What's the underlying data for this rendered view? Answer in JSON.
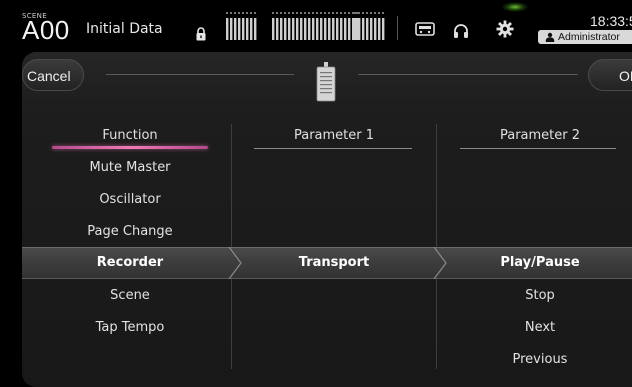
{
  "status_bar": {
    "scene_tag": "SCENE",
    "scene_number": "A00",
    "scene_name": "Initial Data",
    "time": "18:33:5",
    "user": "Administrator"
  },
  "icons": {
    "lock": "lock-icon",
    "meter": "level-meter-icon",
    "recorder": "recorder-icon",
    "headphones": "headphones-icon",
    "settings": "gear-icon",
    "user": "user-icon"
  },
  "colors": {
    "accent_underline": "#f07ab8",
    "led": "#78dc3c"
  },
  "panel": {
    "cancel_label": "Cancel",
    "ok_label": "OK"
  },
  "columns": {
    "function": {
      "header": "Function",
      "items": [
        "Mute Master",
        "Oscillator",
        "Page Change",
        "Recorder",
        "Scene",
        "Tap Tempo"
      ],
      "selected": "Recorder"
    },
    "parameter1": {
      "header": "Parameter 1",
      "items": [
        "Transport"
      ],
      "selected": "Transport"
    },
    "parameter2": {
      "header": "Parameter 2",
      "items": [
        "Play/Pause",
        "Stop",
        "Next",
        "Previous"
      ],
      "selected": "Play/Pause"
    }
  }
}
